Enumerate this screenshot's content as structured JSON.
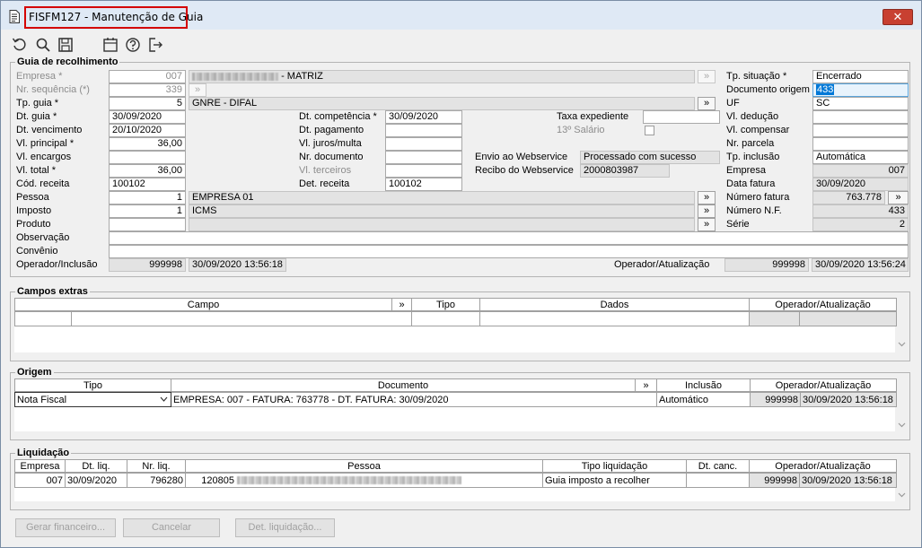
{
  "window": {
    "title": "FISFM127 - Manutenção de Guia",
    "close_glyph": "✕"
  },
  "toolbar": {
    "icons": [
      "refresh-icon",
      "search-icon",
      "save-icon",
      "calendar-icon",
      "help-icon",
      "exit-icon"
    ]
  },
  "guia": {
    "section_title": "Guia de recolhimento",
    "empresa": {
      "label": "Empresa *",
      "code": "007",
      "name_suffix": "- MATRIZ"
    },
    "nr_sequencia": {
      "label": "Nr. sequência (*)",
      "value": "339"
    },
    "tp_guia": {
      "label": "Tp. guia *",
      "code": "5",
      "desc": "GNRE - DIFAL"
    },
    "dt_guia": {
      "label": "Dt. guia *",
      "value": "30/09/2020"
    },
    "dt_vencimento": {
      "label": "Dt. vencimento",
      "value": "20/10/2020"
    },
    "vl_principal": {
      "label": "Vl. principal *",
      "value": "36,00"
    },
    "vl_encargos": {
      "label": "Vl. encargos",
      "value": ""
    },
    "vl_total": {
      "label": "Vl. total *",
      "value": "36,00"
    },
    "cod_receita": {
      "label": "Cód. receita",
      "value": "100102"
    },
    "pessoa": {
      "label": "Pessoa",
      "code": "1",
      "desc": "EMPRESA 01"
    },
    "imposto": {
      "label": "Imposto",
      "code": "1",
      "desc": "ICMS"
    },
    "produto": {
      "label": "Produto",
      "code": "",
      "desc": ""
    },
    "observacao": {
      "label": "Observação",
      "value": ""
    },
    "convenio": {
      "label": "Convênio",
      "value": ""
    },
    "operador_inclusao": {
      "label": "Operador/Inclusão",
      "code": "999998",
      "datetime": "30/09/2020 13:56:18"
    },
    "dt_competencia": {
      "label": "Dt. competência *",
      "value": "30/09/2020"
    },
    "dt_pagamento": {
      "label": "Dt. pagamento",
      "value": ""
    },
    "vl_juros_multa": {
      "label": "Vl. juros/multa",
      "value": ""
    },
    "nr_documento": {
      "label": "Nr. documento",
      "value": ""
    },
    "vl_terceiros": {
      "label": "Vl. terceiros",
      "value": ""
    },
    "det_receita": {
      "label": "Det. receita",
      "value": "100102"
    },
    "taxa_expediente": {
      "label": "Taxa expediente",
      "value": ""
    },
    "decimo_terceiro": {
      "label": "13º Salário"
    },
    "envio_webservice": {
      "label": "Envio ao Webservice",
      "value": "Processado com sucesso"
    },
    "recibo_webservice": {
      "label": "Recibo do Webservice",
      "value": "2000803987"
    },
    "tp_situacao": {
      "label": "Tp. situação *",
      "value": "Encerrado"
    },
    "documento_origem": {
      "label": "Documento origem",
      "value": "433"
    },
    "uf": {
      "label": "UF",
      "value": "SC"
    },
    "vl_deducao": {
      "label": "Vl. dedução",
      "value": ""
    },
    "vl_compensar": {
      "label": "Vl. compensar",
      "value": ""
    },
    "nr_parcela": {
      "label": "Nr. parcela",
      "value": ""
    },
    "tp_inclusao": {
      "label": "Tp. inclusão",
      "value": "Automática"
    },
    "empresa_right": {
      "label": "Empresa",
      "value": "007"
    },
    "data_fatura": {
      "label": "Data fatura",
      "value": "30/09/2020"
    },
    "numero_fatura": {
      "label": "Número fatura",
      "value": "763.778"
    },
    "numero_nf": {
      "label": "Número N.F.",
      "value": "433"
    },
    "serie": {
      "label": "Série",
      "value": "2"
    },
    "operador_atualizacao": {
      "label": "Operador/Atualização",
      "code": "999998",
      "datetime": "30/09/2020 13:56:24"
    },
    "lookup_glyph": "»"
  },
  "campos_extras": {
    "section_title": "Campos extras",
    "columns": [
      "Campo",
      "»",
      "Tipo",
      "Dados",
      "Operador/Atualização"
    ]
  },
  "origem": {
    "section_title": "Origem",
    "columns": [
      "Tipo",
      "Documento",
      "»",
      "Inclusão",
      "Operador/Atualização"
    ],
    "row": {
      "tipo": "Nota Fiscal",
      "documento": "EMPRESA: 007 - FATURA: 763778 - DT. FATURA: 30/09/2020",
      "inclusao": "Automático",
      "operador": "999998",
      "atualizacao": "30/09/2020 13:56:18"
    }
  },
  "liquidacao": {
    "section_title": "Liquidação",
    "columns": [
      "Empresa",
      "Dt. liq.",
      "Nr. liq.",
      "Pessoa",
      "Tipo liquidação",
      "Dt. canc.",
      "Operador/Atualização"
    ],
    "row": {
      "empresa": "007",
      "dt_liq": "30/09/2020",
      "nr_liq": "796280",
      "pessoa_code": "120805",
      "tipo_liquidacao": "Guia imposto a recolher",
      "dt_canc": "",
      "operador": "999998",
      "atualizacao": "30/09/2020 13:56:18"
    }
  },
  "buttons": {
    "gerar_financeiro": "Gerar financeiro...",
    "cancelar": "Cancelar",
    "det_liquidacao": "Det. liquidação..."
  }
}
